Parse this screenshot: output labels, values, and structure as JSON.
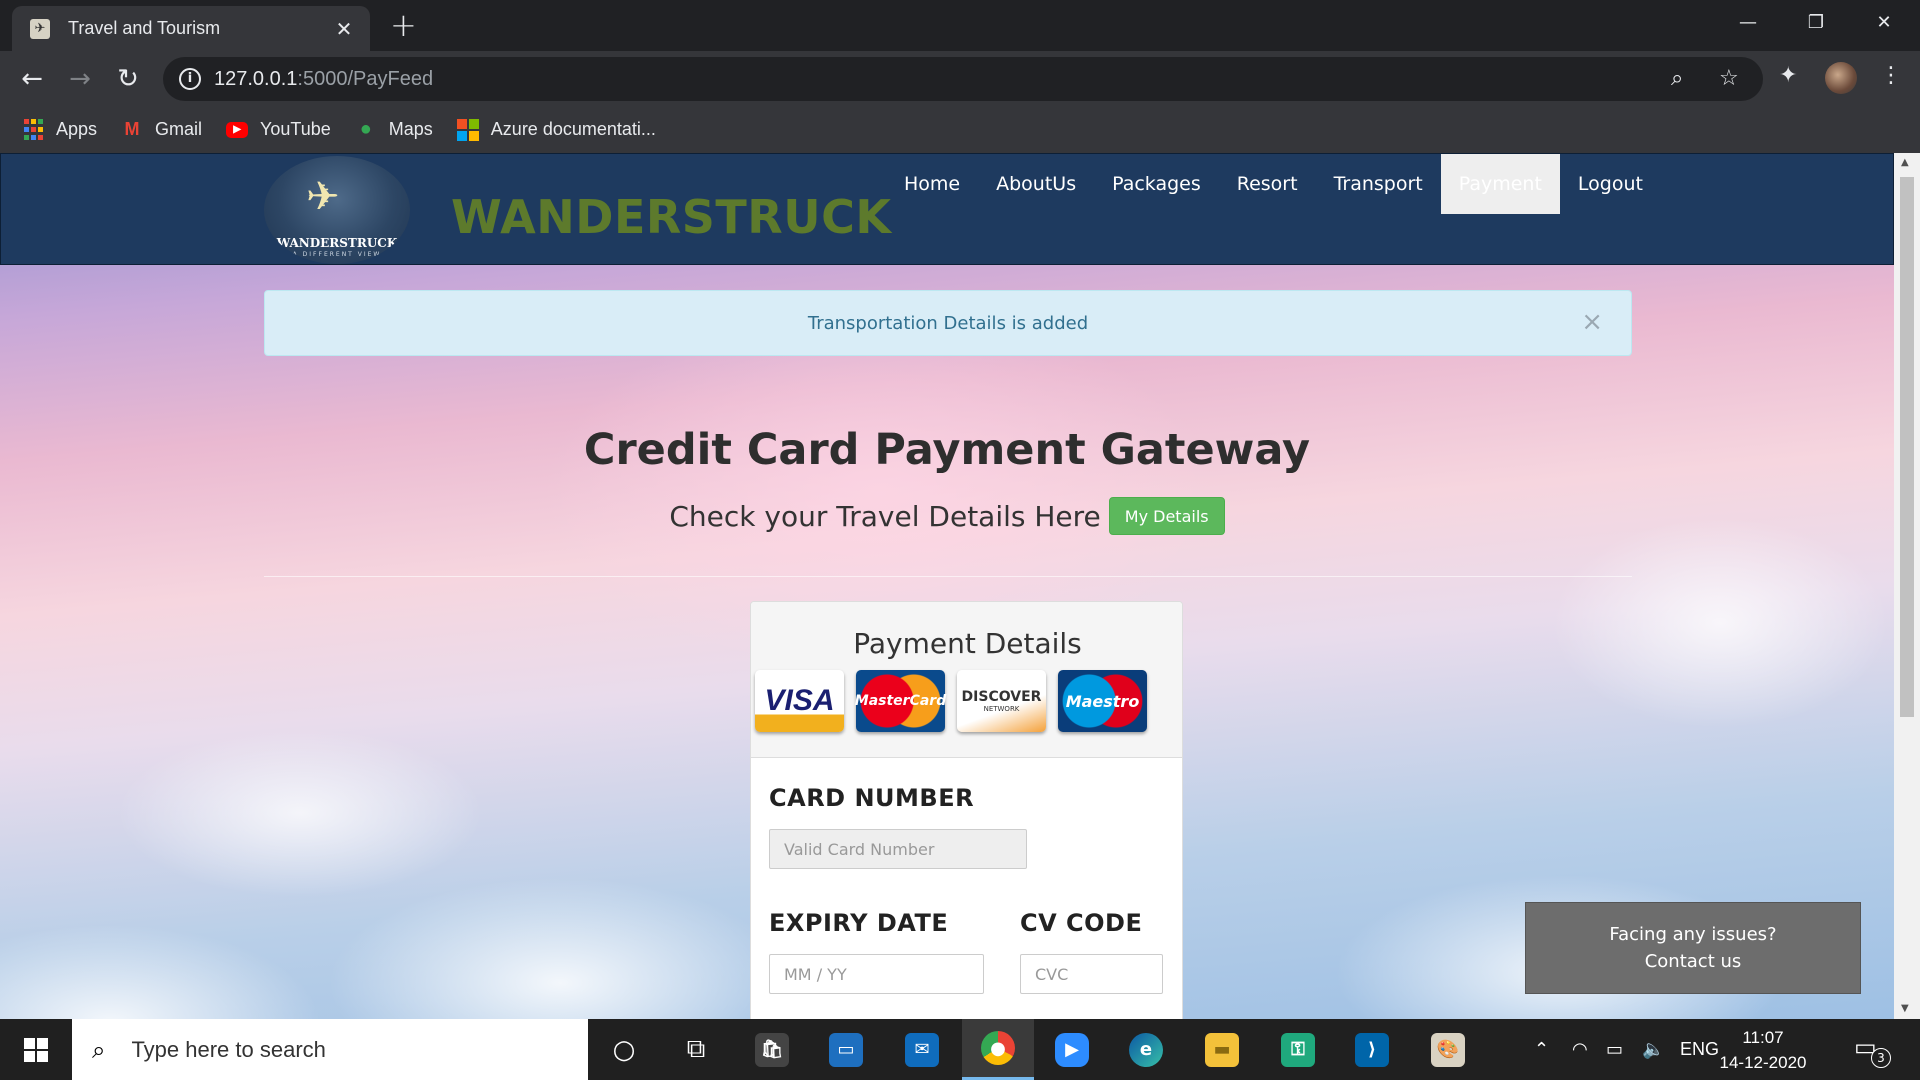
{
  "browser": {
    "tab_title": "Travel and Tourism",
    "tab_close": "✕",
    "new_tab": "+",
    "url_host": "127.0.0.1",
    "url_rest": ":5000/PayFeed",
    "bookmarks": [
      "Apps",
      "Gmail",
      "YouTube",
      "Maps",
      "Azure documentati..."
    ]
  },
  "site": {
    "logo_text": "WANDERSTRUCK",
    "logo_sub": "A DIFFERENT VIEW",
    "brand": "WANDERSTRUCK",
    "nav": [
      "Home",
      "AboutUs",
      "Packages",
      "Resort",
      "Transport",
      "Payment",
      "Logout"
    ],
    "active_nav": "Payment"
  },
  "alert": {
    "message": "Transportation Details is added",
    "close": "×"
  },
  "main": {
    "title": "Credit Card Payment Gateway",
    "subtitle": "Check your Travel Details Here",
    "details_button": "My Details"
  },
  "payment": {
    "panel_title": "Payment Details",
    "cards": [
      "VISA",
      "MasterCard",
      "DISCOVER",
      "NETWORK",
      "Maestro"
    ],
    "card_number_label": "CARD NUMBER",
    "card_number_placeholder": "Valid Card Number",
    "expiry_label": "EXPIRY DATE",
    "expiry_placeholder": "MM / YY",
    "cvc_label": "CV CODE",
    "cvc_placeholder": "CVC"
  },
  "contact": {
    "line1": "Facing any issues?",
    "line2": "Contact us"
  },
  "taskbar": {
    "search_placeholder": "Type here to search",
    "language": "ENG",
    "time": "11:07",
    "date": "14-12-2020",
    "notification_count": "3"
  },
  "colors": {
    "site_nav_bg": "#1e3a5f",
    "brand_green": "#5d7a2c",
    "alert_bg": "#d9edf7",
    "button_green": "#5cb85c",
    "contact_bg": "#6d6d6d"
  }
}
